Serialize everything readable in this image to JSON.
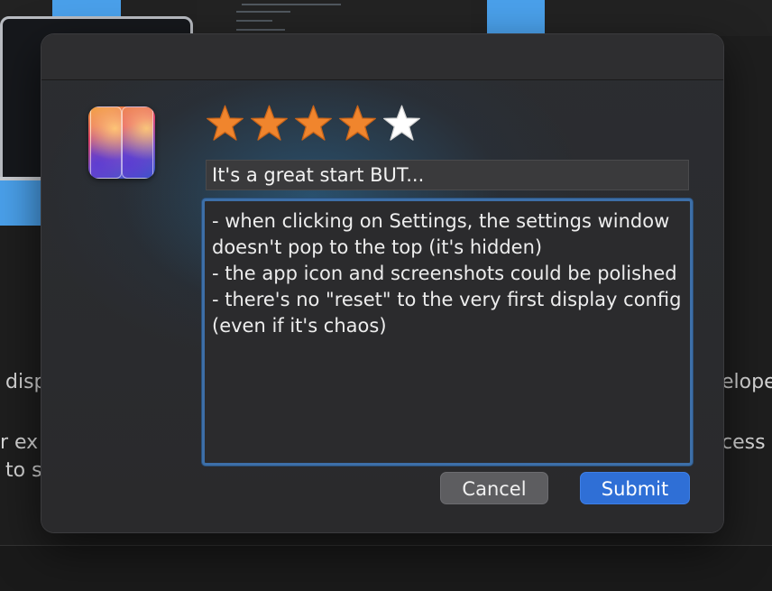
{
  "background": {
    "text_fragments": [
      {
        "text": "disp"
      },
      {
        "text": "r ex"
      },
      {
        "text": "to s"
      },
      {
        "text": "elope"
      },
      {
        "text": "cess b"
      }
    ]
  },
  "dialog": {
    "rating": {
      "value": 4,
      "max": 5,
      "filled_color": "#F0852D",
      "empty_color": "#FFFFFF"
    },
    "app_icon": "split-screen-app-icon",
    "review_title_value": "It's a great start BUT...",
    "review_body_value": "- when clicking on Settings, the settings window doesn't pop to the top (it's hidden)\n- the app icon and screenshots could be polished\n- there's no \"reset\" to the very first display config (even if it's chaos)",
    "cancel_label": "Cancel",
    "submit_label": "Submit",
    "accent_color": "#2F6FD6"
  }
}
